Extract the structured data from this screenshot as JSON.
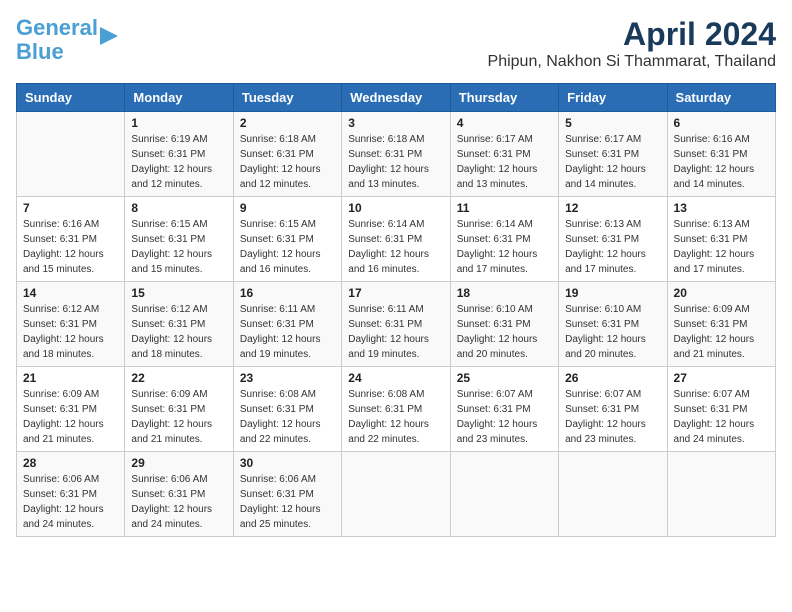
{
  "logo": {
    "text1": "General",
    "text2": "Blue"
  },
  "title": "April 2024",
  "subtitle": "Phipun, Nakhon Si Thammarat, Thailand",
  "weekdays": [
    "Sunday",
    "Monday",
    "Tuesday",
    "Wednesday",
    "Thursday",
    "Friday",
    "Saturday"
  ],
  "weeks": [
    [
      {
        "day": "",
        "sunrise": "",
        "sunset": "",
        "daylight": ""
      },
      {
        "day": "1",
        "sunrise": "Sunrise: 6:19 AM",
        "sunset": "Sunset: 6:31 PM",
        "daylight": "Daylight: 12 hours and 12 minutes."
      },
      {
        "day": "2",
        "sunrise": "Sunrise: 6:18 AM",
        "sunset": "Sunset: 6:31 PM",
        "daylight": "Daylight: 12 hours and 12 minutes."
      },
      {
        "day": "3",
        "sunrise": "Sunrise: 6:18 AM",
        "sunset": "Sunset: 6:31 PM",
        "daylight": "Daylight: 12 hours and 13 minutes."
      },
      {
        "day": "4",
        "sunrise": "Sunrise: 6:17 AM",
        "sunset": "Sunset: 6:31 PM",
        "daylight": "Daylight: 12 hours and 13 minutes."
      },
      {
        "day": "5",
        "sunrise": "Sunrise: 6:17 AM",
        "sunset": "Sunset: 6:31 PM",
        "daylight": "Daylight: 12 hours and 14 minutes."
      },
      {
        "day": "6",
        "sunrise": "Sunrise: 6:16 AM",
        "sunset": "Sunset: 6:31 PM",
        "daylight": "Daylight: 12 hours and 14 minutes."
      }
    ],
    [
      {
        "day": "7",
        "sunrise": "Sunrise: 6:16 AM",
        "sunset": "Sunset: 6:31 PM",
        "daylight": "Daylight: 12 hours and 15 minutes."
      },
      {
        "day": "8",
        "sunrise": "Sunrise: 6:15 AM",
        "sunset": "Sunset: 6:31 PM",
        "daylight": "Daylight: 12 hours and 15 minutes."
      },
      {
        "day": "9",
        "sunrise": "Sunrise: 6:15 AM",
        "sunset": "Sunset: 6:31 PM",
        "daylight": "Daylight: 12 hours and 16 minutes."
      },
      {
        "day": "10",
        "sunrise": "Sunrise: 6:14 AM",
        "sunset": "Sunset: 6:31 PM",
        "daylight": "Daylight: 12 hours and 16 minutes."
      },
      {
        "day": "11",
        "sunrise": "Sunrise: 6:14 AM",
        "sunset": "Sunset: 6:31 PM",
        "daylight": "Daylight: 12 hours and 17 minutes."
      },
      {
        "day": "12",
        "sunrise": "Sunrise: 6:13 AM",
        "sunset": "Sunset: 6:31 PM",
        "daylight": "Daylight: 12 hours and 17 minutes."
      },
      {
        "day": "13",
        "sunrise": "Sunrise: 6:13 AM",
        "sunset": "Sunset: 6:31 PM",
        "daylight": "Daylight: 12 hours and 17 minutes."
      }
    ],
    [
      {
        "day": "14",
        "sunrise": "Sunrise: 6:12 AM",
        "sunset": "Sunset: 6:31 PM",
        "daylight": "Daylight: 12 hours and 18 minutes."
      },
      {
        "day": "15",
        "sunrise": "Sunrise: 6:12 AM",
        "sunset": "Sunset: 6:31 PM",
        "daylight": "Daylight: 12 hours and 18 minutes."
      },
      {
        "day": "16",
        "sunrise": "Sunrise: 6:11 AM",
        "sunset": "Sunset: 6:31 PM",
        "daylight": "Daylight: 12 hours and 19 minutes."
      },
      {
        "day": "17",
        "sunrise": "Sunrise: 6:11 AM",
        "sunset": "Sunset: 6:31 PM",
        "daylight": "Daylight: 12 hours and 19 minutes."
      },
      {
        "day": "18",
        "sunrise": "Sunrise: 6:10 AM",
        "sunset": "Sunset: 6:31 PM",
        "daylight": "Daylight: 12 hours and 20 minutes."
      },
      {
        "day": "19",
        "sunrise": "Sunrise: 6:10 AM",
        "sunset": "Sunset: 6:31 PM",
        "daylight": "Daylight: 12 hours and 20 minutes."
      },
      {
        "day": "20",
        "sunrise": "Sunrise: 6:09 AM",
        "sunset": "Sunset: 6:31 PM",
        "daylight": "Daylight: 12 hours and 21 minutes."
      }
    ],
    [
      {
        "day": "21",
        "sunrise": "Sunrise: 6:09 AM",
        "sunset": "Sunset: 6:31 PM",
        "daylight": "Daylight: 12 hours and 21 minutes."
      },
      {
        "day": "22",
        "sunrise": "Sunrise: 6:09 AM",
        "sunset": "Sunset: 6:31 PM",
        "daylight": "Daylight: 12 hours and 21 minutes."
      },
      {
        "day": "23",
        "sunrise": "Sunrise: 6:08 AM",
        "sunset": "Sunset: 6:31 PM",
        "daylight": "Daylight: 12 hours and 22 minutes."
      },
      {
        "day": "24",
        "sunrise": "Sunrise: 6:08 AM",
        "sunset": "Sunset: 6:31 PM",
        "daylight": "Daylight: 12 hours and 22 minutes."
      },
      {
        "day": "25",
        "sunrise": "Sunrise: 6:07 AM",
        "sunset": "Sunset: 6:31 PM",
        "daylight": "Daylight: 12 hours and 23 minutes."
      },
      {
        "day": "26",
        "sunrise": "Sunrise: 6:07 AM",
        "sunset": "Sunset: 6:31 PM",
        "daylight": "Daylight: 12 hours and 23 minutes."
      },
      {
        "day": "27",
        "sunrise": "Sunrise: 6:07 AM",
        "sunset": "Sunset: 6:31 PM",
        "daylight": "Daylight: 12 hours and 24 minutes."
      }
    ],
    [
      {
        "day": "28",
        "sunrise": "Sunrise: 6:06 AM",
        "sunset": "Sunset: 6:31 PM",
        "daylight": "Daylight: 12 hours and 24 minutes."
      },
      {
        "day": "29",
        "sunrise": "Sunrise: 6:06 AM",
        "sunset": "Sunset: 6:31 PM",
        "daylight": "Daylight: 12 hours and 24 minutes."
      },
      {
        "day": "30",
        "sunrise": "Sunrise: 6:06 AM",
        "sunset": "Sunset: 6:31 PM",
        "daylight": "Daylight: 12 hours and 25 minutes."
      },
      {
        "day": "",
        "sunrise": "",
        "sunset": "",
        "daylight": ""
      },
      {
        "day": "",
        "sunrise": "",
        "sunset": "",
        "daylight": ""
      },
      {
        "day": "",
        "sunrise": "",
        "sunset": "",
        "daylight": ""
      },
      {
        "day": "",
        "sunrise": "",
        "sunset": "",
        "daylight": ""
      }
    ]
  ]
}
